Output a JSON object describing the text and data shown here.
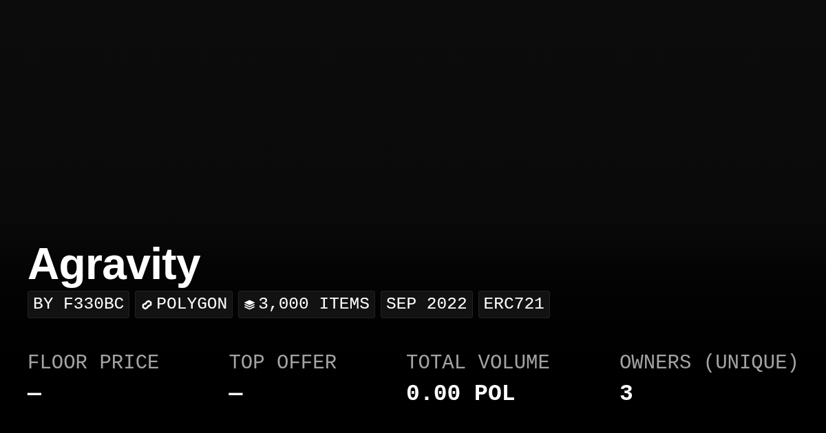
{
  "collection": {
    "title": "Agravity"
  },
  "tags": [
    {
      "kind": "text",
      "label": "BY F330BC"
    },
    {
      "kind": "link",
      "label": "POLYGON"
    },
    {
      "kind": "layers",
      "label": "3,000 ITEMS"
    },
    {
      "kind": "text",
      "label": "SEP 2022"
    },
    {
      "kind": "text",
      "label": "ERC721"
    }
  ],
  "stats": [
    {
      "label": "FLOOR PRICE",
      "value": "—"
    },
    {
      "label": "TOP OFFER",
      "value": "—"
    },
    {
      "label": "TOTAL VOLUME",
      "value": "0.00 POL"
    },
    {
      "label": "OWNERS (UNIQUE)",
      "value": "3"
    }
  ]
}
